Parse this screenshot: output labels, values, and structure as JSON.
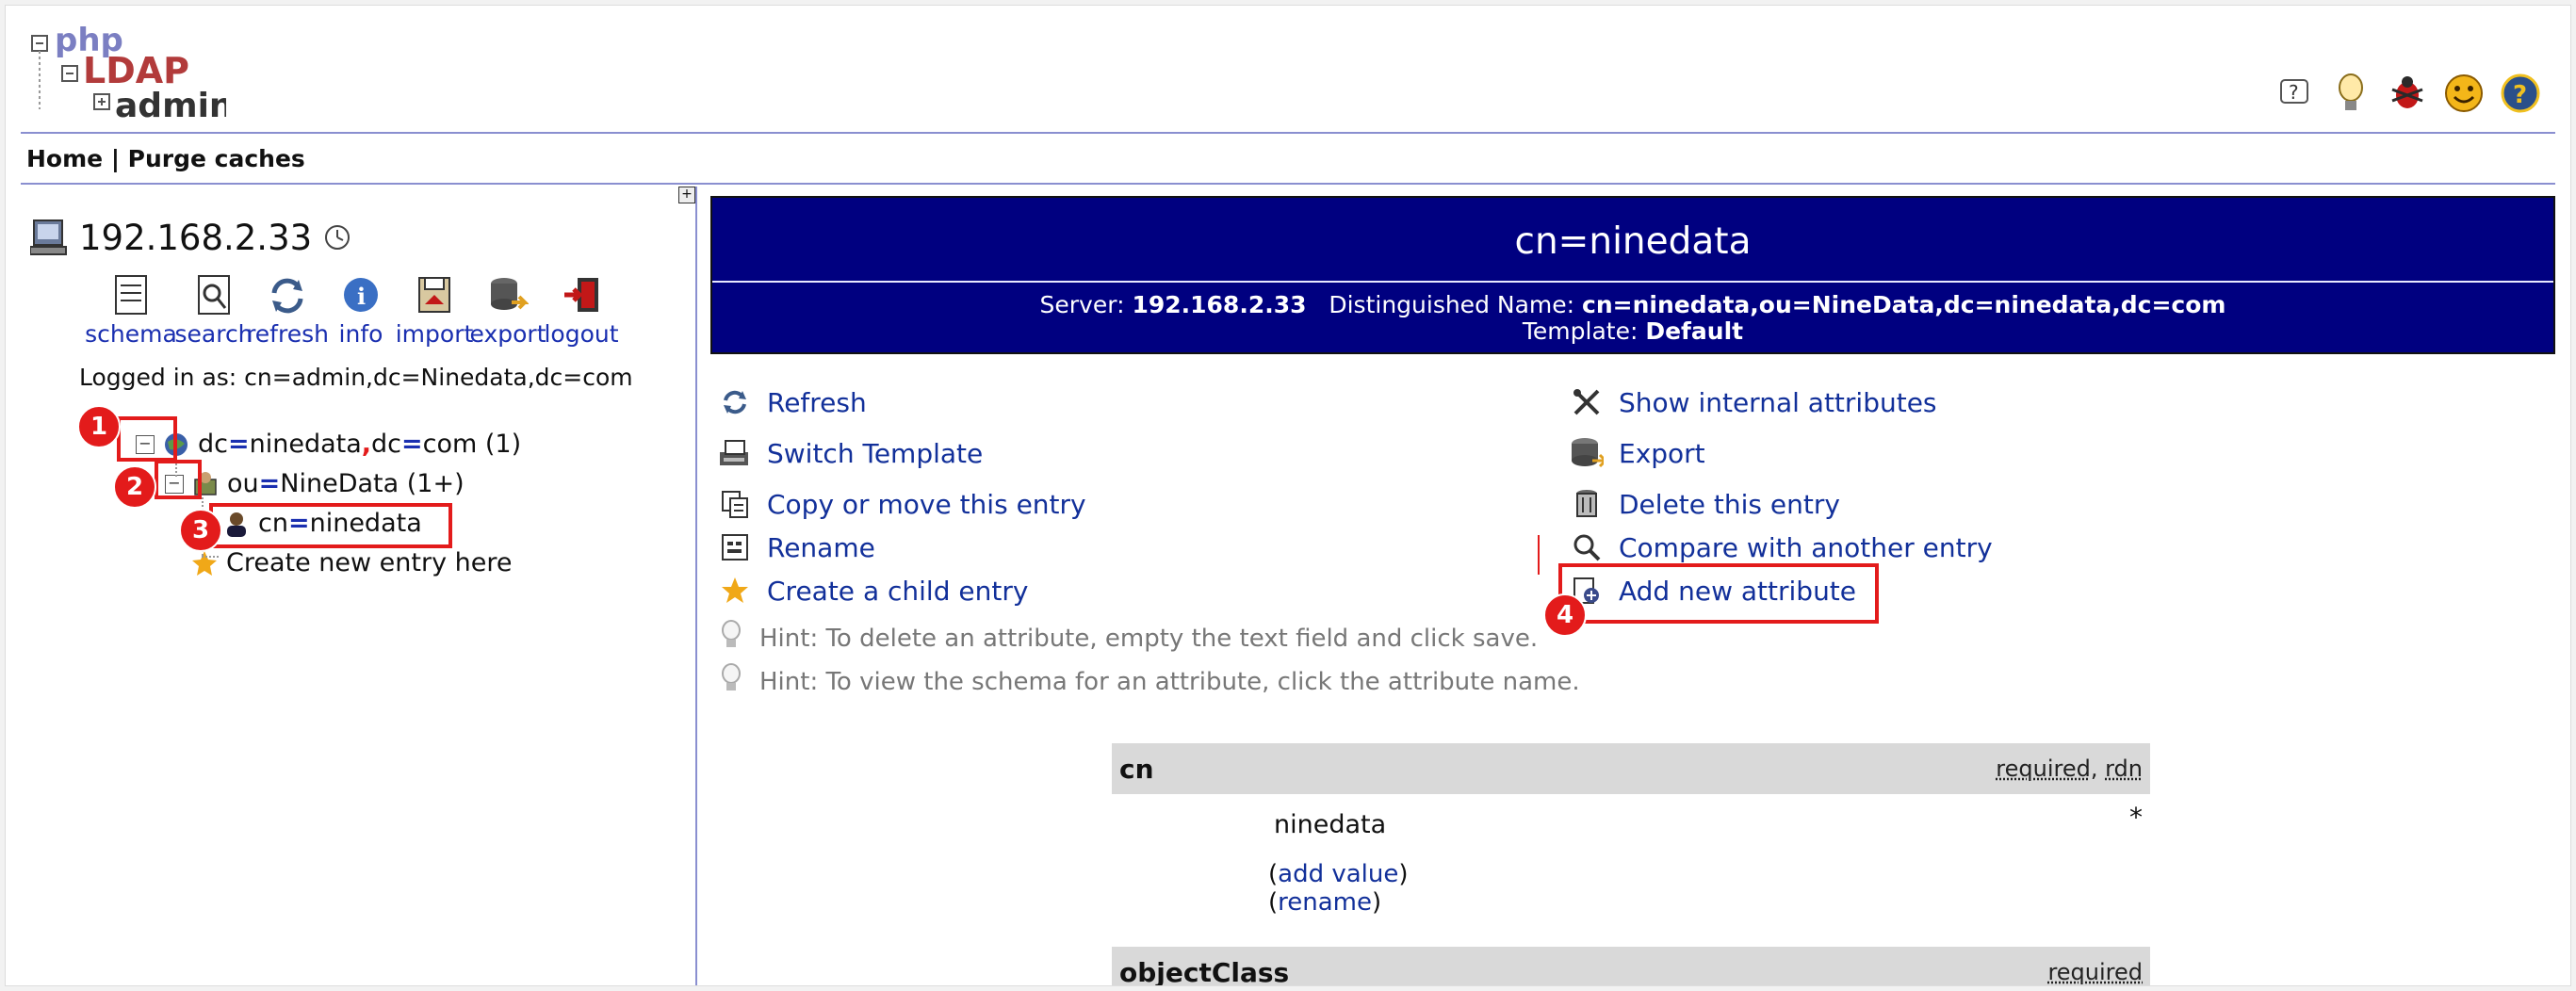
{
  "header": {
    "logo_text": [
      "php",
      "LDAP",
      "admin"
    ],
    "icons": [
      "help-icon",
      "hint-bulb-icon",
      "bug-icon",
      "smiley-icon",
      "question-icon"
    ]
  },
  "topnav": {
    "home": "Home",
    "separator": " | ",
    "purge": "Purge caches"
  },
  "server": {
    "name": "192.168.2.33",
    "tools": [
      {
        "label": "schema",
        "icon": "schema-icon"
      },
      {
        "label": "search",
        "icon": "search-icon"
      },
      {
        "label": "refresh",
        "icon": "refresh-icon"
      },
      {
        "label": "info",
        "icon": "info-icon"
      },
      {
        "label": "import",
        "icon": "import-icon"
      },
      {
        "label": "export",
        "icon": "export-icon"
      },
      {
        "label": "logout",
        "icon": "logout-icon"
      }
    ],
    "logged_in": "Logged in as: cn=admin,dc=Ninedata,dc=com"
  },
  "tree": {
    "root": {
      "a1": "dc",
      "v1": "ninedata",
      "sep": ",",
      "a2": "dc",
      "v2": "com",
      "count": " (1)"
    },
    "ou": {
      "a": "ou",
      "v": "NineData",
      "count": " (1+)"
    },
    "cn": {
      "a": "cn",
      "v": "ninedata"
    },
    "create": "Create new entry here"
  },
  "badges": [
    "1",
    "2",
    "3",
    "4"
  ],
  "entry": {
    "title": "cn=ninedata",
    "server_label": "Server: ",
    "server_value": "192.168.2.33",
    "dn_label": "Distinguished Name: ",
    "dn_value": "cn=ninedata,ou=NineData,dc=ninedata,dc=com",
    "template_label": "Template: ",
    "template_value": "Default"
  },
  "actions_left": [
    "Refresh",
    "Switch Template",
    "Copy or move this entry",
    "Rename",
    "Create a child entry"
  ],
  "actions_right": [
    "Show internal attributes",
    "Export",
    "Delete this entry",
    "Compare with another entry",
    "Add new attribute"
  ],
  "hints": [
    "Hint: To delete an attribute, empty the text field and click save.",
    "Hint: To view the schema for an attribute, click the attribute name."
  ],
  "attributes": {
    "cn": {
      "name": "cn",
      "flag1": "required",
      "flag_sep": ", ",
      "flag2": "rdn",
      "value": "ninedata",
      "marker": "*",
      "add_value": "add value",
      "rename": "rename"
    },
    "objectClass": {
      "name": "objectClass",
      "flag1": "required"
    }
  },
  "colors": {
    "accent": "#000080",
    "link": "#12309a",
    "highlight": "#e31b1b"
  }
}
